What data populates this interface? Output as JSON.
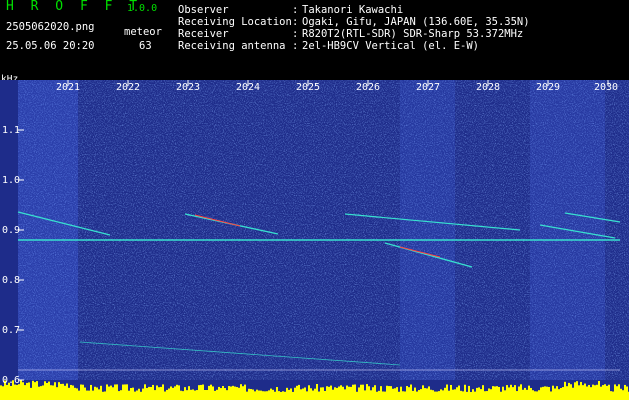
{
  "app": {
    "title": "H R O F F T",
    "version": "1.0.0",
    "filename": "2505062020.png",
    "datetime": "25.05.06 20:20",
    "mode": "meteor",
    "count": "63"
  },
  "meta": [
    {
      "label": "Observer",
      "value": "Takanori Kawachi"
    },
    {
      "label": "Receiving Location",
      "value": "Ogaki, Gifu, JAPAN (136.60E, 35.35N)"
    },
    {
      "label": "Receiver",
      "value": "R820T2(RTL-SDR) SDR-Sharp 53.372MHz"
    },
    {
      "label": "Receiving antenna",
      "value": "2el-HB9CV Vertical (el. E-W)"
    }
  ],
  "spectrogram": {
    "unit": "kHz",
    "time_ticks": [
      "2021",
      "2022",
      "2023",
      "2024",
      "2025",
      "2026",
      "2027",
      "2028",
      "2029",
      "2030"
    ],
    "freq_ticks": [
      "1.1",
      "1.0",
      "0.9",
      "0.8",
      "0.7",
      "0.6"
    ],
    "colors": {
      "background": "#000000",
      "noise": "#1e2c8a",
      "signal": "#38e0d0",
      "hot": "#ff4040",
      "level": "#ffff00",
      "title": "#00e000"
    }
  }
}
